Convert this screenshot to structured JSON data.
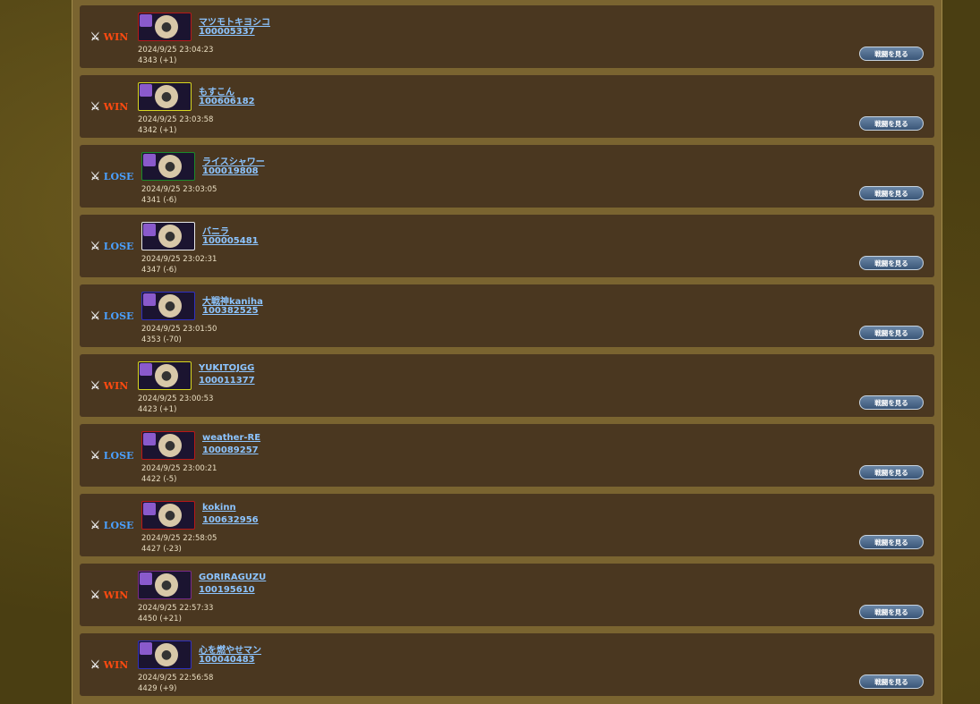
{
  "battle_log": [
    {
      "result": "WIN",
      "name": "マツモトキヨシコ",
      "id": "100005337",
      "datetime": "2024/9/25 23:04:23",
      "score": "4343 (+1)",
      "border": "#b81818",
      "watch": "戦闘を見る"
    },
    {
      "result": "WIN",
      "name": "もすこん",
      "id": "100606182",
      "datetime": "2024/9/25 23:03:58",
      "score": "4342 (+1)",
      "border": "#d8d820",
      "watch": "戦闘を見る"
    },
    {
      "result": "LOSE",
      "name": "ライスシャワー",
      "id": "100019808",
      "datetime": "2024/9/25 23:03:05",
      "score": "4341 (-6)",
      "border": "#1a8a2a",
      "watch": "戦闘を見る"
    },
    {
      "result": "LOSE",
      "name": "バニラ",
      "id": "100005481",
      "datetime": "2024/9/25 23:02:31",
      "score": "4347 (-6)",
      "border": "#e8e8e8",
      "watch": "戦闘を見る"
    },
    {
      "result": "LOSE",
      "name": "大戦神kaniha",
      "id": "100382525",
      "datetime": "2024/9/25 23:01:50",
      "score": "4353 (-70)",
      "border": "#3030c0",
      "watch": "戦闘を見る"
    },
    {
      "result": "WIN",
      "name": "YUKITOJGG",
      "id": "100011377",
      "datetime": "2024/9/25 23:00:53",
      "score": "4423 (+1)",
      "border": "#d8d820",
      "watch": "戦闘を見る"
    },
    {
      "result": "LOSE",
      "name": "weather-RE",
      "id": "100089257",
      "datetime": "2024/9/25 23:00:21",
      "score": "4422 (-5)",
      "border": "#b81818",
      "watch": "戦闘を見る"
    },
    {
      "result": "LOSE",
      "name": "kokinn",
      "id": "100632956",
      "datetime": "2024/9/25 22:58:05",
      "score": "4427 (-23)",
      "border": "#b81818",
      "watch": "戦闘を見る"
    },
    {
      "result": "WIN",
      "name": "GORIRAGUZU",
      "id": "100195610",
      "datetime": "2024/9/25 22:57:33",
      "score": "4450 (+21)",
      "border": "#7a2a8a",
      "watch": "戦闘を見る"
    },
    {
      "result": "WIN",
      "name": "心を燃やせマン",
      "id": "100040483",
      "datetime": "2024/9/25 22:56:58",
      "score": "4429 (+9)",
      "border": "#3030c0",
      "watch": "戦闘を見る"
    }
  ],
  "icons": {
    "result": "crossed-swords-icon",
    "avatar": "user-avatar-icon"
  },
  "colors": {
    "win": "#ff4a10",
    "lose": "#4aa0ff",
    "link": "#8cc4ff"
  }
}
